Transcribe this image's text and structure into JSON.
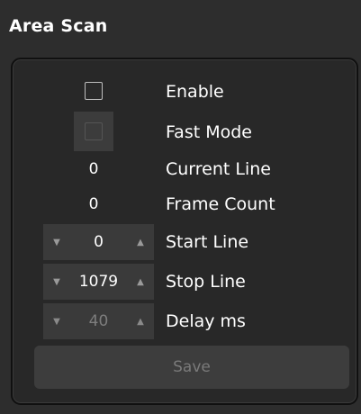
{
  "header": {
    "title": "Area Scan"
  },
  "controls": {
    "enable": {
      "label": "Enable",
      "checked": false
    },
    "fast_mode": {
      "label": "Fast Mode",
      "checked": false,
      "disabled": true
    },
    "current_line": {
      "label": "Current Line",
      "value": "0"
    },
    "frame_count": {
      "label": "Frame Count",
      "value": "0"
    },
    "start_line": {
      "label": "Start Line",
      "value": "0"
    },
    "stop_line": {
      "label": "Stop Line",
      "value": "1079"
    },
    "delay_ms": {
      "label": "Delay ms",
      "value": "40",
      "disabled": true
    }
  },
  "footer": {
    "save_label": "Save",
    "save_disabled": true
  },
  "icons": {
    "decrement": "chevron-down-icon",
    "increment": "chevron-up-icon"
  },
  "colors": {
    "background": "#2d2d2d",
    "panel": "#282828",
    "control": "#3a3a3a",
    "text": "#ffffff",
    "disabled_text": "#7a7a7a"
  }
}
